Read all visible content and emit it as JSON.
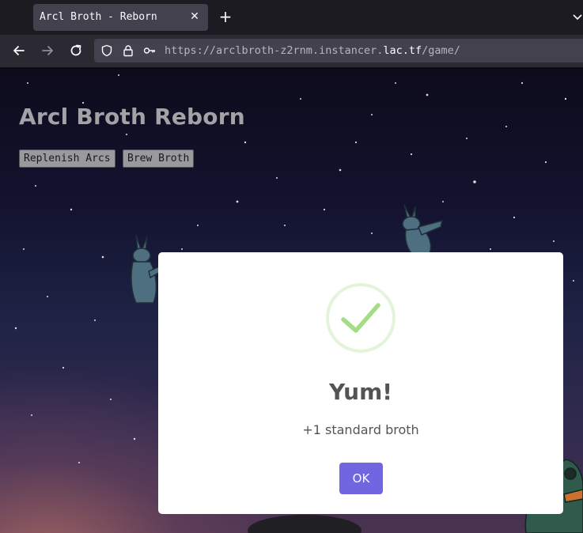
{
  "browser": {
    "tab_title": "Arcl Broth - Reborn",
    "tab_close_glyph": "✕",
    "new_tab_glyph": "+",
    "url": {
      "prefix": "https://arclbroth-z2rnm.instancer.",
      "domain": "lac.tf",
      "path": "/game/"
    },
    "icons": [
      "back-arrow-icon",
      "forward-arrow-icon",
      "reload-icon",
      "shield-icon",
      "lock-icon",
      "key-icon",
      "chevron-down-icon"
    ]
  },
  "page": {
    "title": "Arcl Broth Reborn",
    "buttons": {
      "replenish": "Replenish Arcs",
      "brew": "Brew Broth"
    }
  },
  "modal": {
    "title": "Yum!",
    "text": "+1 standard broth",
    "ok_label": "OK",
    "icon": "success-check-icon"
  },
  "colors": {
    "accent": "#7066e0",
    "success": "#a5dc86",
    "modal_text": "#545454",
    "heading": "#a3a3a7"
  }
}
